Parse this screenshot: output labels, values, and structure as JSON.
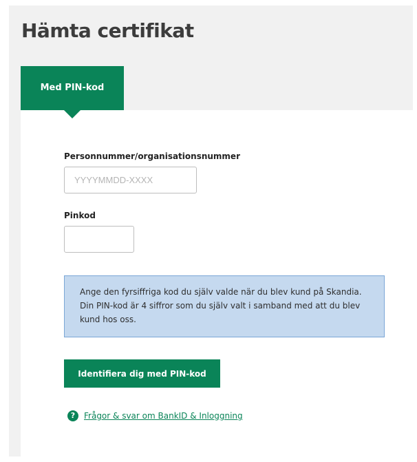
{
  "page": {
    "title": "Hämta certifikat"
  },
  "tabs": [
    {
      "label": "Med PIN-kod",
      "selected": true
    }
  ],
  "form": {
    "personnummer": {
      "label": "Personnummer/organisationsnummer",
      "placeholder": "YYYYMMDD-XXXX",
      "value": ""
    },
    "pinkod": {
      "label": "Pinkod",
      "value": ""
    }
  },
  "info_text": "Ange den fyrsiffriga kod du själv valde när du blev kund på Skandia. Din PIN-kod är 4 siffror som du själv valt i samband med att du blev kund hos oss.",
  "submit_button_label": "Identifiera dig med PIN-kod",
  "help": {
    "icon": "question-circle-icon",
    "link_text": "Frågor & svar om BankID & Inloggning"
  },
  "colors": {
    "brand_green": "#0a8458",
    "info_background": "#c5d9ef",
    "info_border": "#7aa6d6",
    "panel_background": "#f1f1f1"
  }
}
